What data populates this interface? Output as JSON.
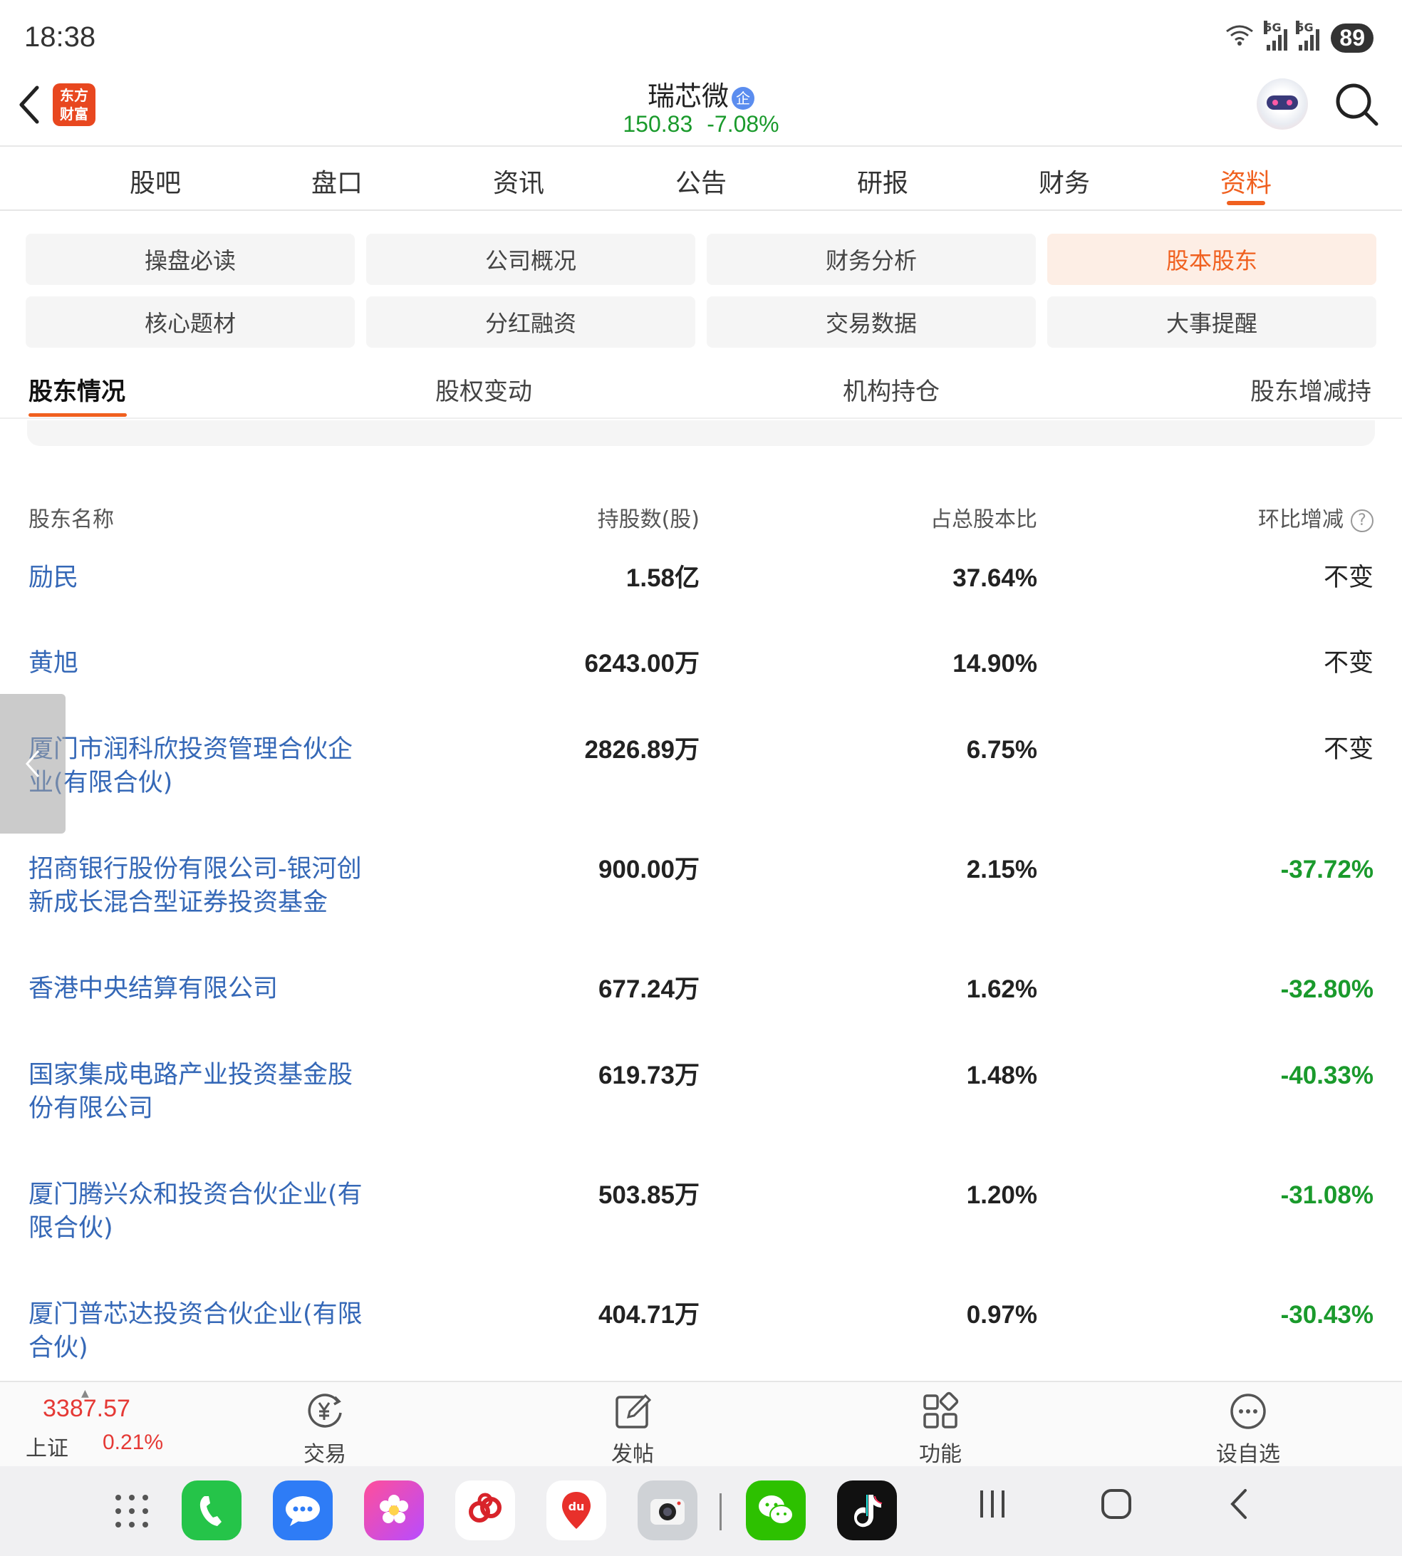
{
  "status_bar": {
    "time": "18:38",
    "battery": "89",
    "network_1": "5G",
    "network_2": "5G",
    "wifi_sub": "6"
  },
  "header": {
    "logo_line1": "东方",
    "logo_line2": "财富",
    "stock_name": "瑞芯微",
    "badge": "企",
    "price": "150.83",
    "change_pct": "-7.08%",
    "price_color": "#1a9a2c"
  },
  "main_tabs": [
    "股吧",
    "盘口",
    "资讯",
    "公告",
    "研报",
    "财务",
    "资料"
  ],
  "main_tabs_active": "资料",
  "sub_nav": {
    "row1": [
      "操盘必读",
      "公司概况",
      "财务分析",
      "股本股东"
    ],
    "row2": [
      "核心题材",
      "分红融资",
      "交易数据",
      "大事提醒"
    ],
    "active": "股本股东"
  },
  "section_tabs": [
    "股东情况",
    "股权变动",
    "机构持仓",
    "股东增减持"
  ],
  "section_active": "股东情况",
  "table": {
    "headers": {
      "name": "股东名称",
      "shares": "持股数(股)",
      "ratio": "占总股本比",
      "change": "环比增减",
      "help": "?"
    },
    "rows": [
      {
        "name": "励民",
        "shares": "1.58亿",
        "ratio": "37.64%",
        "change": "不变"
      },
      {
        "name": "黄旭",
        "shares": "6243.00万",
        "ratio": "14.90%",
        "change": "不变"
      },
      {
        "name": "厦门市润科欣投资管理合伙企业(有限合伙)",
        "shares": "2826.89万",
        "ratio": "6.75%",
        "change": "不变"
      },
      {
        "name": "招商银行股份有限公司-银河创新成长混合型证券投资基金",
        "shares": "900.00万",
        "ratio": "2.15%",
        "change": "-37.72%"
      },
      {
        "name": "香港中央结算有限公司",
        "shares": "677.24万",
        "ratio": "1.62%",
        "change": "-32.80%"
      },
      {
        "name": "国家集成电路产业投资基金股份有限公司",
        "shares": "619.73万",
        "ratio": "1.48%",
        "change": "-40.33%"
      },
      {
        "name": "厦门腾兴众和投资合伙企业(有限合伙)",
        "shares": "503.85万",
        "ratio": "1.20%",
        "change": "-31.08%"
      },
      {
        "name": "厦门普芯达投资合伙企业(有限合伙)",
        "shares": "404.71万",
        "ratio": "0.97%",
        "change": "-30.43%"
      }
    ]
  },
  "bottom_bar": {
    "index_value": "3387.57",
    "index_name": "上证",
    "index_pct": "0.21%",
    "items": [
      "交易",
      "发帖",
      "功能",
      "设自选"
    ]
  },
  "colors": {
    "accent": "#f0601f",
    "link": "#3568b7",
    "negative": "#1a9a2c",
    "positive": "#e53935"
  },
  "icons": [
    "back-icon",
    "search-icon",
    "robot-avatar-icon",
    "help-icon",
    "trade-icon",
    "post-icon",
    "function-icon",
    "watchlist-icon"
  ]
}
